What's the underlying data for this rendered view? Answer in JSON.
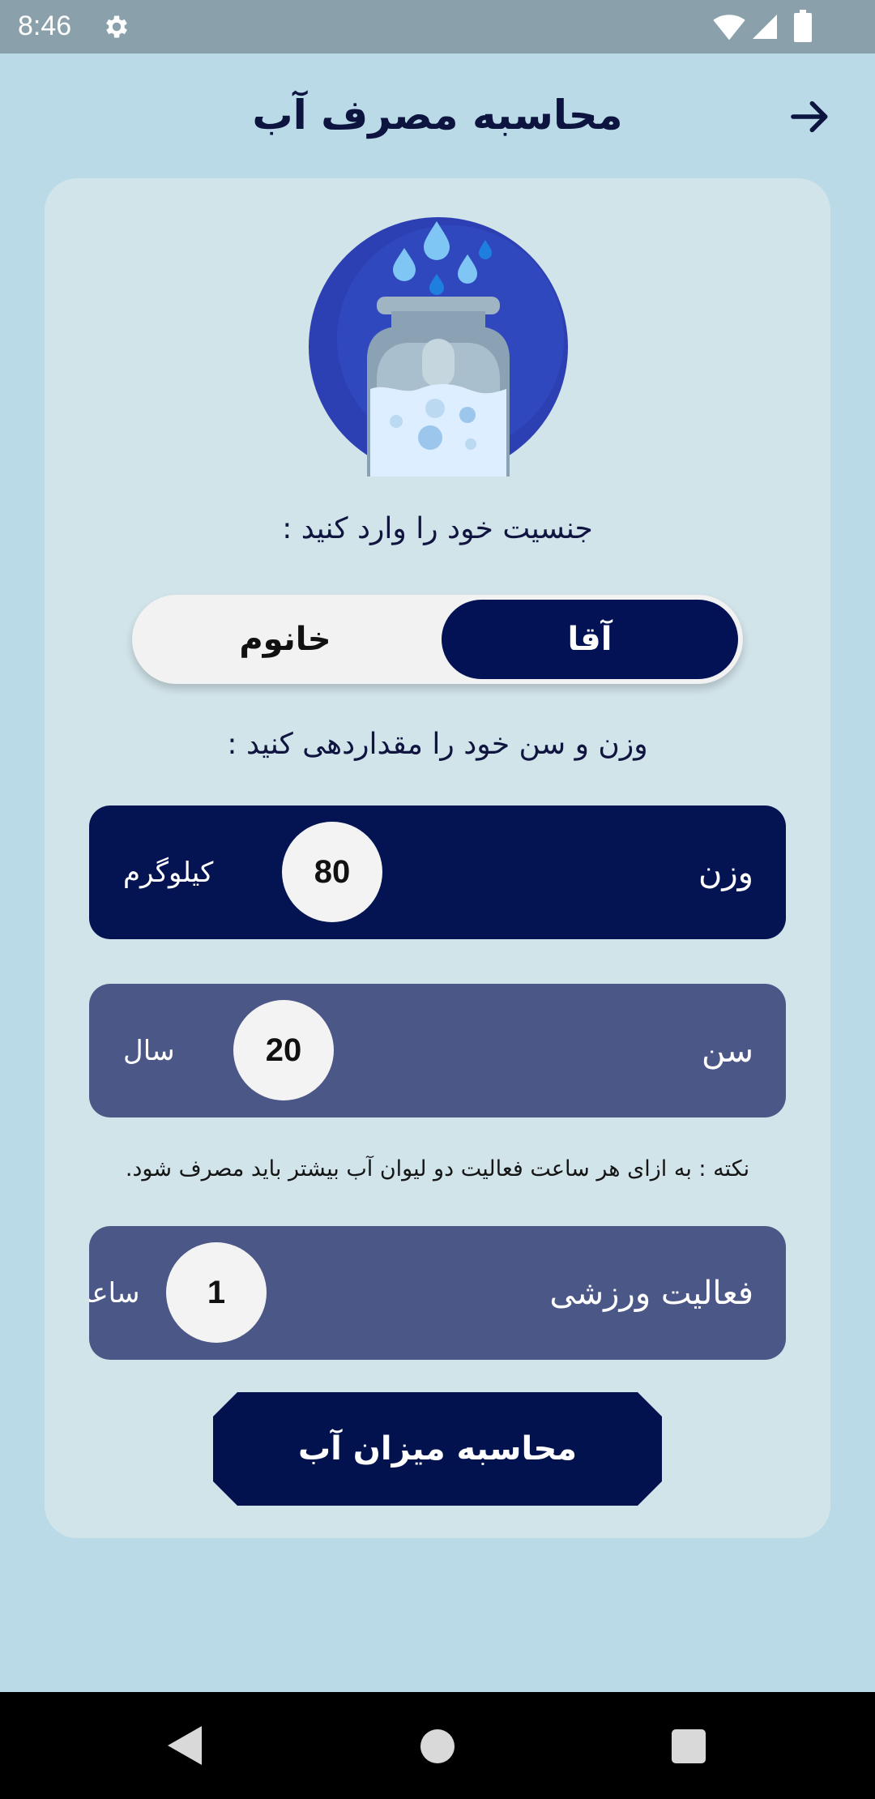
{
  "status_bar": {
    "time": "8:46",
    "icons": [
      "settings-gear-icon",
      "wifi-icon",
      "signal-icon",
      "battery-icon"
    ]
  },
  "header": {
    "title": "محاسبه مصرف آب",
    "back_icon": "arrow-right-icon"
  },
  "illustration": {
    "icon": "water-jar-illustration"
  },
  "gender": {
    "prompt": "جنسیت خود را وارد کنید :",
    "options": [
      "آقا",
      "خانوم"
    ],
    "selected": "آقا"
  },
  "measurements": {
    "prompt": "وزن و سن خود را مقداردهی کنید :",
    "weight": {
      "label": "وزن",
      "value": "80",
      "unit": "کیلوگرم"
    },
    "age": {
      "label": "سن",
      "value": "20",
      "unit": "سال"
    }
  },
  "note": "نکته : به ازای هر ساعت فعالیت دو لیوان آب بیشتر باید مصرف شود.",
  "activity": {
    "label": "فعالیت ورزشی",
    "value": "1",
    "unit": "ساعت"
  },
  "calculate_button": {
    "label": "محاسبه میزان آب"
  },
  "colors": {
    "background": "#b9dae6",
    "card": "#d1e4ea",
    "primary_navy": "#041352",
    "secondary_slate": "#4b5786",
    "knob": "#f3f3f3"
  },
  "nav_bar": {
    "icons": [
      "back-triangle-icon",
      "home-circle-icon",
      "recents-square-icon"
    ]
  }
}
